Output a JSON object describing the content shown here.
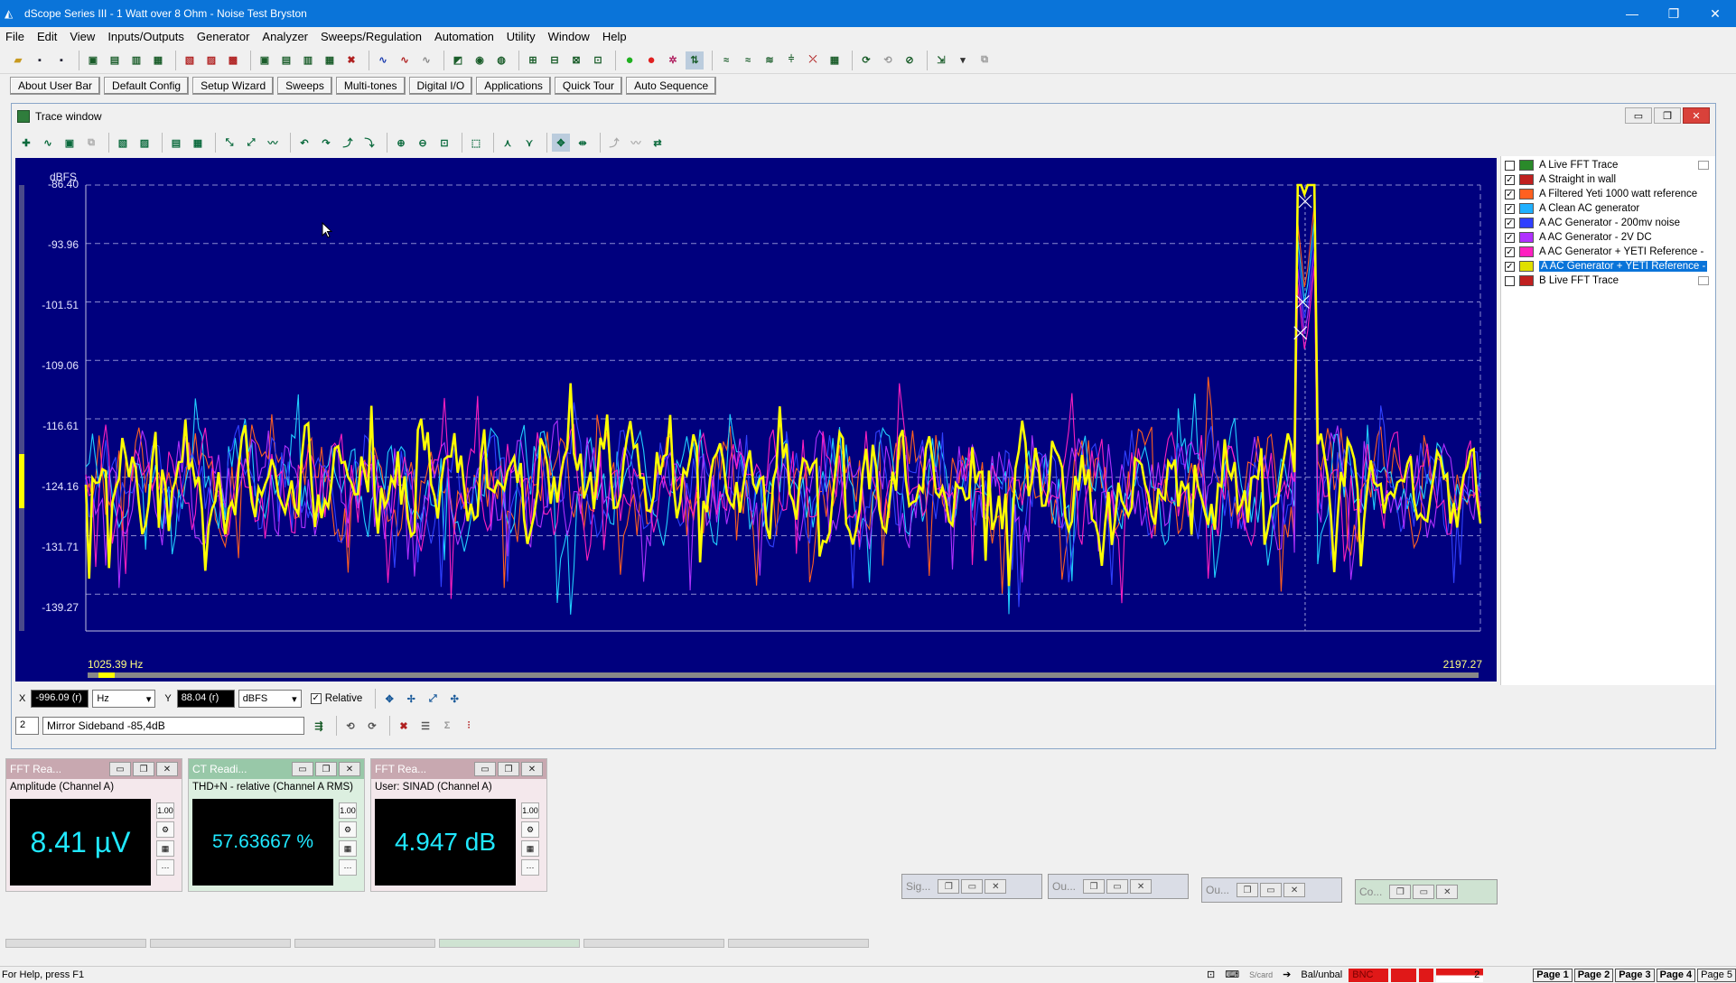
{
  "window": {
    "title": "dScope Series III - 1 Watt over 8 Ohm - Noise Test Bryston",
    "controls": [
      "—",
      "❐",
      "✕"
    ]
  },
  "menu": [
    "File",
    "Edit",
    "View",
    "Inputs/Outputs",
    "Generator",
    "Analyzer",
    "Sweeps/Regulation",
    "Automation",
    "Utility",
    "Window",
    "Help"
  ],
  "userbar": [
    "About User Bar",
    "Default Config",
    "Setup Wizard",
    "Sweeps",
    "Multi-tones",
    "Digital I/O",
    "Applications",
    "Quick Tour",
    "Auto Sequence"
  ],
  "trace_window": {
    "title": "Trace window",
    "y_unit": "dBFS",
    "y_ticks": [
      "-86.40",
      "-93.96",
      "-101.51",
      "-109.06",
      "-116.61",
      "-124.16",
      "-131.71",
      "-139.27"
    ],
    "x_min_label": "1025.39 Hz",
    "x_max_label": "2197.27"
  },
  "chart_data": {
    "type": "line",
    "ylim": [
      -144.0,
      -86.4
    ],
    "xlim": [
      1025.39,
      2197.27
    ],
    "grid": true,
    "cursor_x": 2050.0,
    "peak": {
      "x": 2050.0,
      "y": -88.5
    },
    "series": [
      {
        "name": "Filtered Yeti 1000 watt reference",
        "color": "#ff6020",
        "seed": 3
      },
      {
        "name": "Clean AC generator",
        "color": "#20d0ff",
        "seed": 7
      },
      {
        "name": "AC Generator - 200mv noise",
        "color": "#3040ff",
        "seed": 11
      },
      {
        "name": "AC Generator - 2V DC",
        "color": "#b030ff",
        "seed": 17
      },
      {
        "name": "AC Generator + YETI Reference -",
        "color": "#ff20c0",
        "seed": 23
      },
      {
        "name": "AC Generator + YETI Reference -",
        "color": "#ffff00",
        "seed": 31
      }
    ]
  },
  "legend": [
    {
      "label": "A  Live FFT Trace",
      "checked": false,
      "color": "#2a8a2a",
      "selected": false,
      "dup": true
    },
    {
      "label": "A  Straight in wall",
      "checked": true,
      "color": "#c02020",
      "selected": false,
      "dup": false
    },
    {
      "label": "A  Filtered Yeti 1000 watt reference",
      "checked": true,
      "color": "#ff6020",
      "selected": false,
      "dup": false
    },
    {
      "label": "A  Clean AC generator",
      "checked": true,
      "color": "#20b0ff",
      "selected": false,
      "dup": false
    },
    {
      "label": "A   AC Generator - 200mv noise",
      "checked": true,
      "color": "#3040ff",
      "selected": false,
      "dup": false
    },
    {
      "label": "A  AC Generator - 2V DC",
      "checked": true,
      "color": "#b030ff",
      "selected": false,
      "dup": false
    },
    {
      "label": "A  AC Generator + YETI Reference -",
      "checked": true,
      "color": "#ff20c0",
      "selected": false,
      "dup": false
    },
    {
      "label": "A  AC Generator + YETI Reference -",
      "checked": true,
      "color": "#e0e000",
      "selected": true,
      "dup": false
    },
    {
      "label": "B  Live FFT Trace",
      "checked": false,
      "color": "#c02020",
      "selected": false,
      "dup": true
    }
  ],
  "cursor": {
    "x_label": "X",
    "x_value": "-996.09 (r)",
    "x_unit": "Hz",
    "y_label": "Y",
    "y_value": "88.04 (r)",
    "y_unit": "dBFS",
    "relative_label": "Relative",
    "relative_checked": true,
    "marker_index": "2",
    "marker_text": "Mirror Sideband -85,4dB"
  },
  "readouts": [
    {
      "title": "FFT Rea...",
      "subtitle": "Amplitude (Channel A)",
      "value": "8.41 µV",
      "title_bg": "#c8a8b0",
      "bg": "#f4e8ec"
    },
    {
      "title": "CT Readi...",
      "subtitle": "THD+N - relative (Channel A RMS)",
      "value": "57.63667 %",
      "title_bg": "#98c8a8",
      "bg": "#dcefe0"
    },
    {
      "title": "FFT Rea...",
      "subtitle": "User: SINAD (Channel A)",
      "value": "4.947 dB",
      "title_bg": "#c8a8b0",
      "bg": "#f4e8ec"
    }
  ],
  "minimized": [
    {
      "title": "Sig..."
    },
    {
      "title": "Ou..."
    },
    {
      "title": "Ou..."
    },
    {
      "title": "Co..."
    }
  ],
  "status": {
    "help": "For Help, press F1",
    "items": [
      "S/card",
      "Bal/unbal",
      "BNC",
      "2"
    ],
    "pages": [
      "Page 1",
      "Page 2",
      "Page 3",
      "Page 4",
      "Page 5"
    ]
  },
  "colors": {
    "accent": "#0a74d9",
    "plot_bg": "#00007e"
  }
}
